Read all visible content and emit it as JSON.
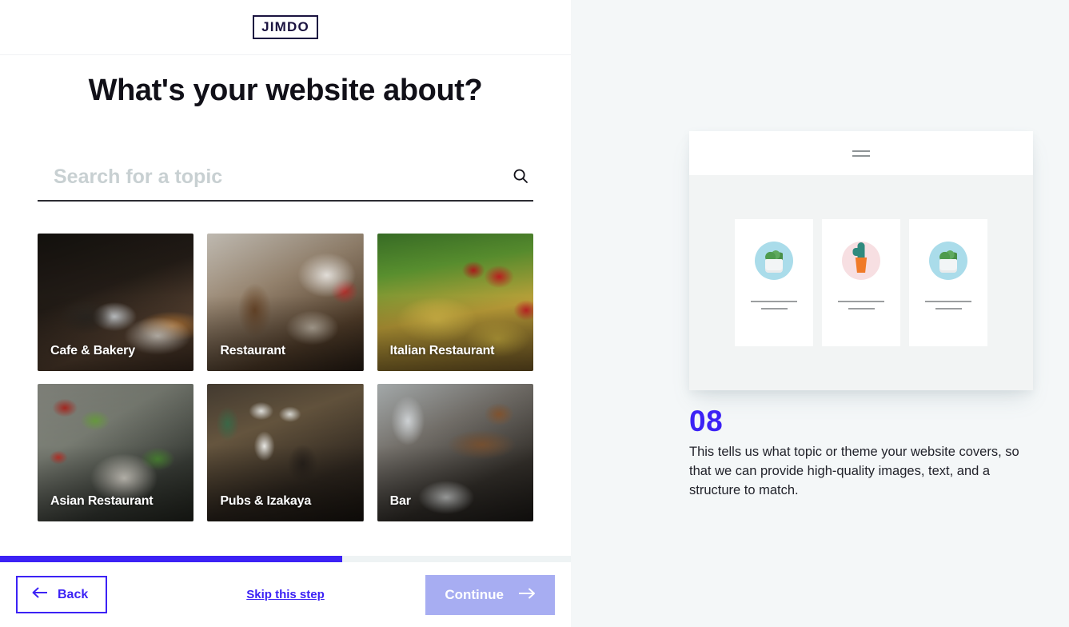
{
  "brand": {
    "logo_text": "JIMDO"
  },
  "header": {
    "title": "What's your website about?"
  },
  "search": {
    "placeholder": "Search for a topic",
    "value": "",
    "icon": "search-icon"
  },
  "topics": [
    {
      "label": "Cafe & Bakery",
      "photo": "cafe"
    },
    {
      "label": "Restaurant",
      "photo": "restaurant"
    },
    {
      "label": "Italian Restaurant",
      "photo": "italian"
    },
    {
      "label": "Asian Restaurant",
      "photo": "asian"
    },
    {
      "label": "Pubs & Izakaya",
      "photo": "pubs"
    },
    {
      "label": "Bar",
      "photo": "bar"
    }
  ],
  "footer": {
    "back_label": "Back",
    "back_icon": "arrow-left-icon",
    "skip_label": "Skip this step",
    "continue_label": "Continue",
    "continue_icon": "arrow-right-icon",
    "progress_percent": 60
  },
  "sidebar": {
    "step_number": "08",
    "description": "This tells us what topic or theme your website covers, so that we can provide high-quality images, text, and a structure to match.",
    "preview": {
      "menu_icon": "hamburger-menu-icon",
      "cards": [
        {
          "plant": "succulent-white-pot",
          "circle": "blue"
        },
        {
          "plant": "cactus-orange-pot",
          "circle": "pink"
        },
        {
          "plant": "succulent-white-pot",
          "circle": "blue"
        }
      ]
    }
  },
  "colors": {
    "accent": "#3c22f5",
    "accent_muted": "#a7adf2",
    "logo_navy": "#1b1340",
    "right_bg": "#f4f7f8",
    "progress_track": "#eef3f4"
  }
}
